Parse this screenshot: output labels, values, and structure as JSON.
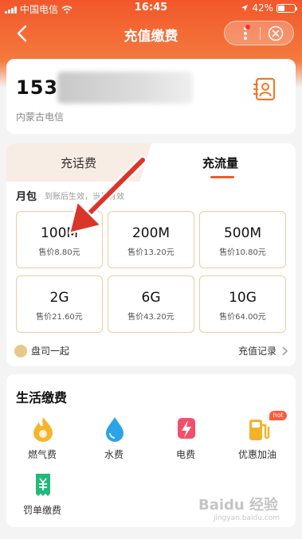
{
  "status_bar": {
    "carrier": "中国电信",
    "time": "16:45",
    "battery": "42%",
    "battery_level": 0.42
  },
  "nav": {
    "title": "充值缴费"
  },
  "account": {
    "phone_prefix": "153",
    "province": "内蒙古电信"
  },
  "topup": {
    "tabs": [
      {
        "label": "充话费",
        "selected": false
      },
      {
        "label": "充流量",
        "selected": true
      }
    ],
    "plan_heading": "月包",
    "plan_note": "到账后生效，当月有效",
    "packages": [
      {
        "size": "100M",
        "price": "售价8.80元"
      },
      {
        "size": "200M",
        "price": "售价13.20元"
      },
      {
        "size": "500M",
        "price": "售价10.80元"
      },
      {
        "size": "2G",
        "price": "售价21.60元"
      },
      {
        "size": "6G",
        "price": "售价43.20元"
      },
      {
        "size": "10G",
        "price": "售价64.00元"
      }
    ],
    "partner": "盘司一起",
    "history_link": "充值记录"
  },
  "life_services": {
    "title": "生活缴费",
    "items": [
      {
        "label": "燃气费",
        "icon": "gas-flame-icon"
      },
      {
        "label": "水费",
        "icon": "water-drop-icon"
      },
      {
        "label": "电费",
        "icon": "lightning-icon"
      },
      {
        "label": "优惠加油",
        "icon": "fuel-pump-icon",
        "badge": "hot"
      },
      {
        "label": "罚单缴费",
        "icon": "ticket-icon"
      }
    ]
  },
  "watermark": {
    "text": "Baidu 经验",
    "sub": "jingyan.baidu.com"
  },
  "colors": {
    "brand_orange": "#f25a2a",
    "package_border": "#f0c9a4",
    "arrow_red": "#d9362b"
  }
}
